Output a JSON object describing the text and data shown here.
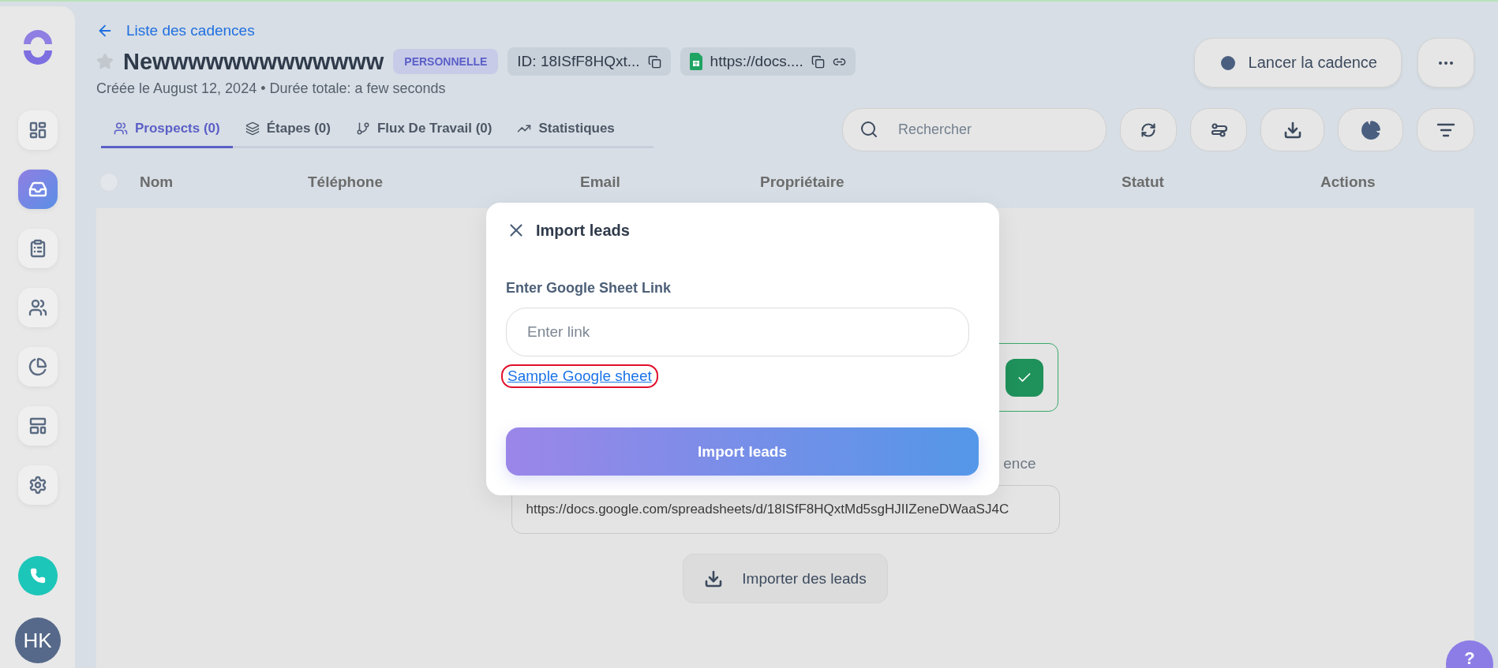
{
  "sidebar": {
    "items": [
      {
        "kind": "dashboard",
        "selected": false
      },
      {
        "kind": "cadences",
        "selected": true
      },
      {
        "kind": "tasks",
        "selected": false
      },
      {
        "kind": "contacts",
        "selected": false
      },
      {
        "kind": "reports",
        "selected": false
      },
      {
        "kind": "templates",
        "selected": false
      },
      {
        "kind": "settings",
        "selected": false
      }
    ]
  },
  "avatar": "HK",
  "back_link": "Liste des cadences",
  "title": "Newwwwwwwwwwwww",
  "starred": false,
  "badge": "PERSONNELLE",
  "id_chip": "ID: 18ISfF8HQxt...",
  "sheet_chip": "https://docs....",
  "subtitle": "Créée le August 12, 2024 • Durée totale: a few seconds",
  "launch_button": "Lancer la cadence",
  "tabs": [
    {
      "kind": "people",
      "label": "Prospects (0)",
      "selected": true
    },
    {
      "kind": "layers",
      "label": "Étapes (0)",
      "selected": false
    },
    {
      "kind": "flow",
      "label": "Flux De Travail (0)",
      "selected": false
    },
    {
      "kind": "stats",
      "label": "Statistiques",
      "selected": false
    }
  ],
  "search": {
    "placeholder": "Rechercher"
  },
  "select_all": {
    "checked": false
  },
  "columns": [
    "Nom",
    "Téléphone",
    "Email",
    "Propriétaire",
    "Statut",
    "Actions"
  ],
  "background": {
    "hint_tail": "ence",
    "sheet_url": "https://docs.google.com/spreadsheets/d/18ISfF8HQxtMd5sgHJIIZeneDWaaSJ4C",
    "import_button": "Importer des leads"
  },
  "modal": {
    "title": "Import leads",
    "field_label": "Enter Google Sheet Link",
    "field": {
      "placeholder": "Enter link"
    },
    "sample_link": "Sample Google sheet",
    "submit": "Import leads"
  },
  "help": "?"
}
